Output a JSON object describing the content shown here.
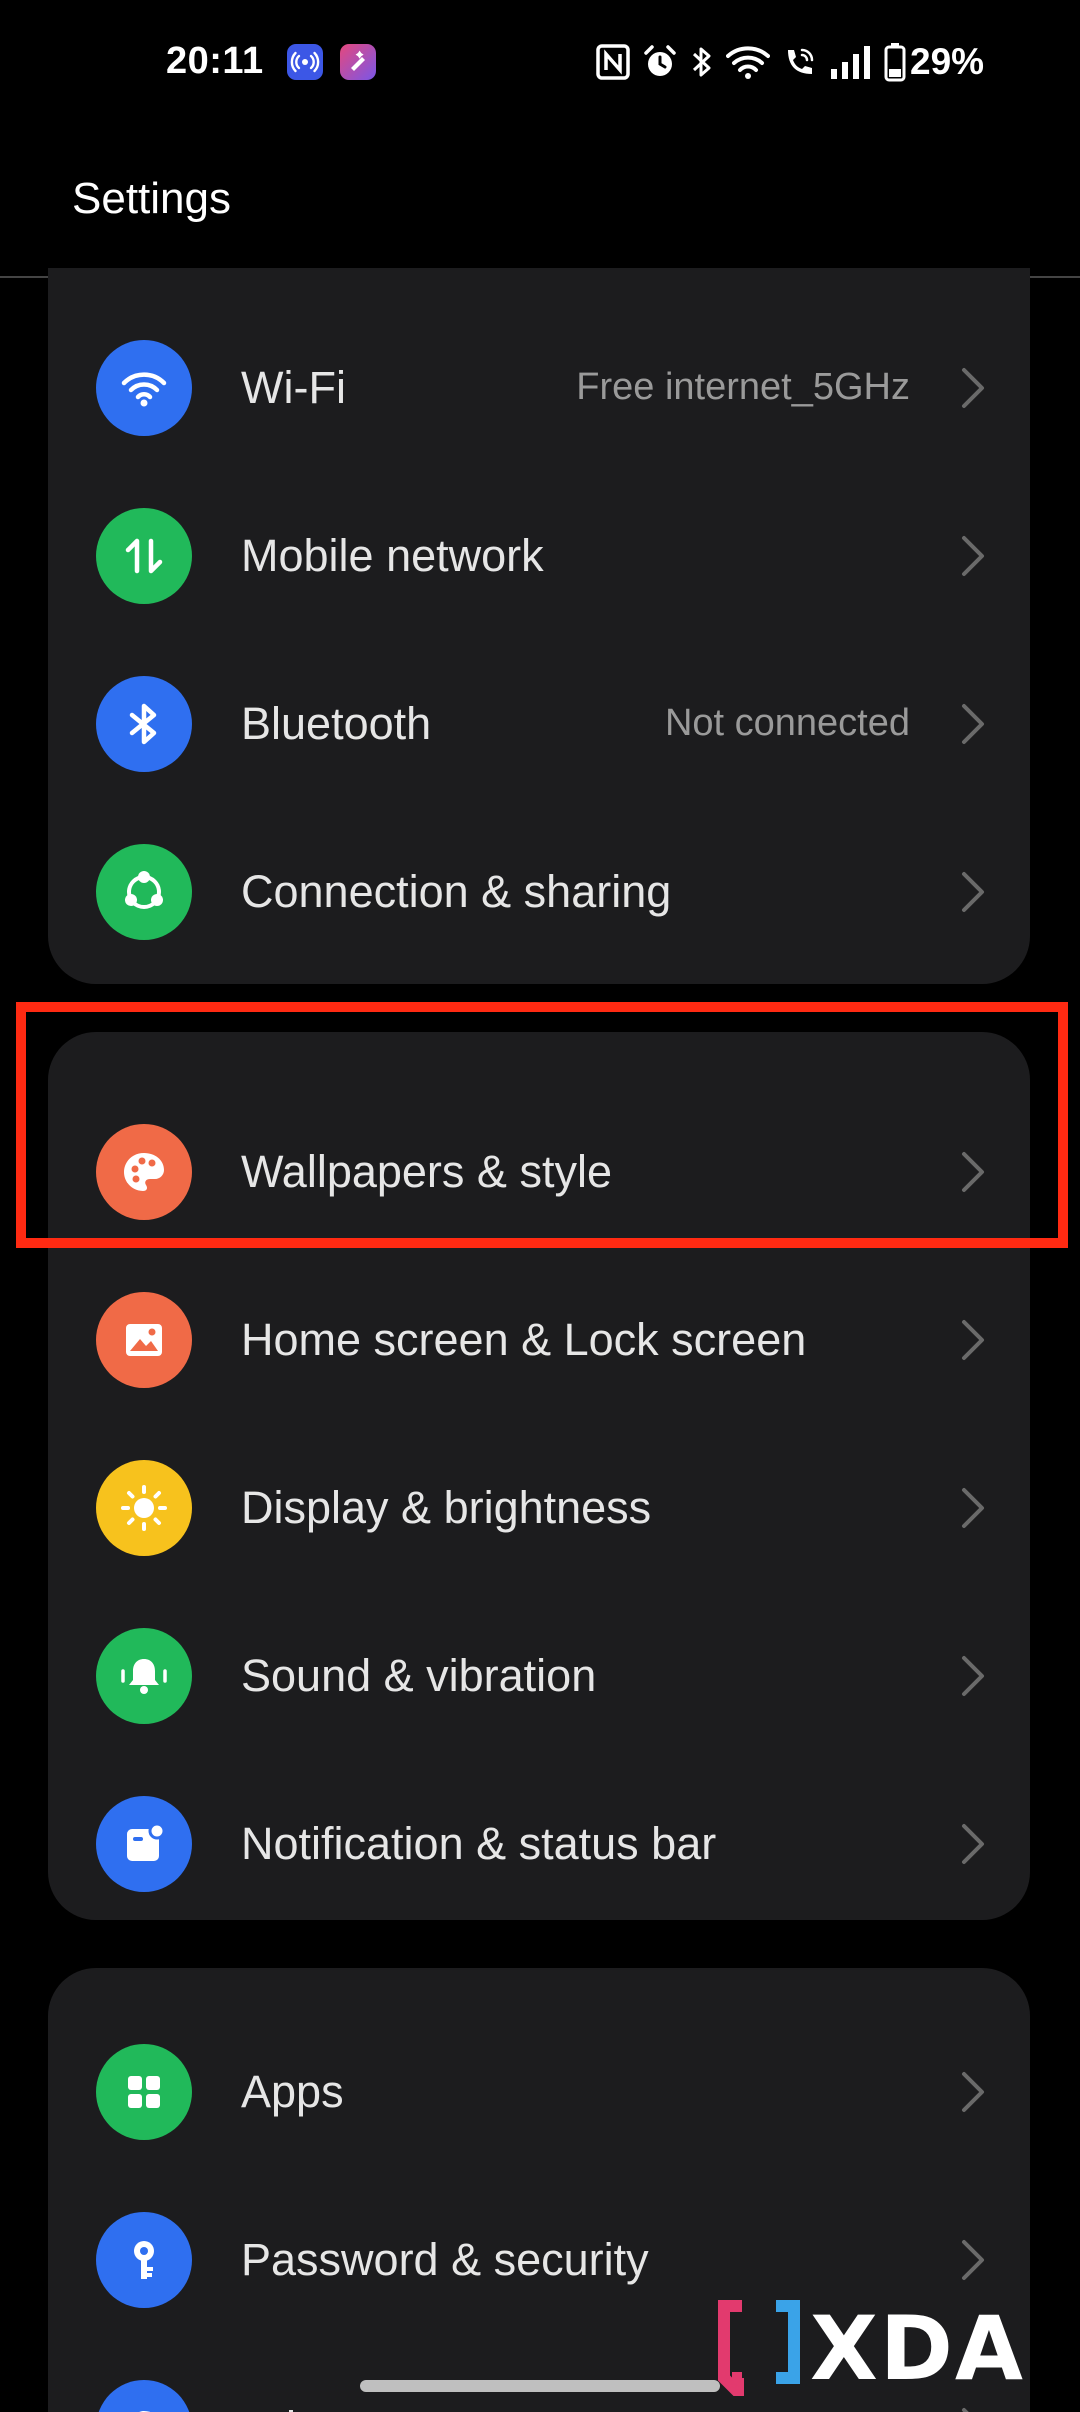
{
  "status_bar": {
    "time": "20:11",
    "battery_percent": "29%",
    "icons": [
      "nfc-icon",
      "alarm-icon",
      "bluetooth-icon",
      "wifi-icon",
      "wifi-calling-icon",
      "signal-icon",
      "battery-icon"
    ]
  },
  "header": {
    "title": "Settings"
  },
  "groups": [
    {
      "items": [
        {
          "label": "Wi-Fi",
          "value": "Free internet_5GHz",
          "icon": "wifi-icon",
          "color": "#2f6ff0"
        },
        {
          "label": "Mobile network",
          "value": "",
          "icon": "mobile-data-icon",
          "color": "#21b95a"
        },
        {
          "label": "Bluetooth",
          "value": "Not connected",
          "icon": "bluetooth-icon",
          "color": "#2f6ff0"
        },
        {
          "label": "Connection & sharing",
          "value": "",
          "icon": "share-icon",
          "color": "#21b95a"
        }
      ]
    },
    {
      "items": [
        {
          "label": "Wallpapers & style",
          "icon": "palette-icon",
          "color": "#f06a47",
          "highlighted": true
        },
        {
          "label": "Home screen & Lock screen",
          "icon": "picture-icon",
          "color": "#f06a47"
        },
        {
          "label": "Display & brightness",
          "icon": "sun-icon",
          "color": "#f7c21d"
        },
        {
          "label": "Sound & vibration",
          "icon": "bell-icon",
          "color": "#21b95a"
        },
        {
          "label": "Notification & status bar",
          "icon": "notification-icon",
          "color": "#2f6ff0"
        }
      ]
    },
    {
      "items": [
        {
          "label": "Apps",
          "icon": "apps-grid-icon",
          "color": "#21b95a"
        },
        {
          "label": "Password & security",
          "icon": "key-icon",
          "color": "#2f6ff0"
        },
        {
          "label": "Privacy",
          "icon": "privacy-icon",
          "color": "#2f6ff0"
        }
      ]
    }
  ],
  "highlight_color": "#ff2a12",
  "watermark": {
    "text": "XDA"
  }
}
